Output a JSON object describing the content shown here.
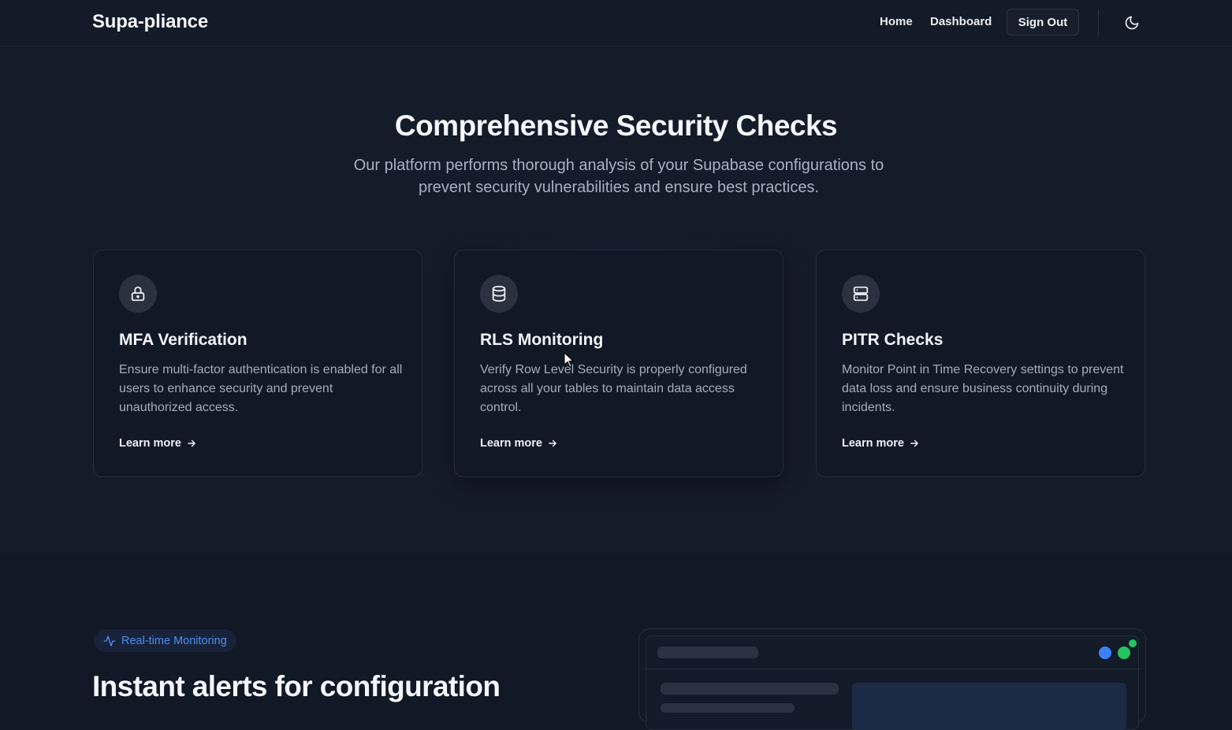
{
  "header": {
    "brand": "Supa-pliance",
    "nav": {
      "home": "Home",
      "dashboard": "Dashboard",
      "sign_out": "Sign Out"
    },
    "theme_icon": "moon-icon"
  },
  "checks": {
    "title": "Comprehensive Security Checks",
    "subtitle_line1": "Our platform performs thorough analysis of your Supabase configurations to",
    "subtitle_line2": "prevent security vulnerabilities and ensure best practices.",
    "cards": [
      {
        "icon": "lock-icon",
        "title": "MFA Verification",
        "description": "Ensure multi-factor authentication is enabled for all users to enhance security and prevent unauthorized access.",
        "link": "Learn more"
      },
      {
        "icon": "database-icon",
        "title": "RLS Monitoring",
        "description": "Verify Row Level Security is properly configured across all your tables to maintain data access control.",
        "link": "Learn more"
      },
      {
        "icon": "server-icon",
        "title": "PITR Checks",
        "description": "Monitor Point in Time Recovery settings to prevent data loss and ensure business continuity during incidents.",
        "link": "Learn more"
      }
    ]
  },
  "monitoring": {
    "badge": "Real-time Monitoring",
    "badge_icon": "activity-icon",
    "title": "Instant alerts for configuration"
  },
  "colors": {
    "accent_blue": "#3b82f6",
    "status_green": "#22c55e",
    "background": "#111826"
  }
}
